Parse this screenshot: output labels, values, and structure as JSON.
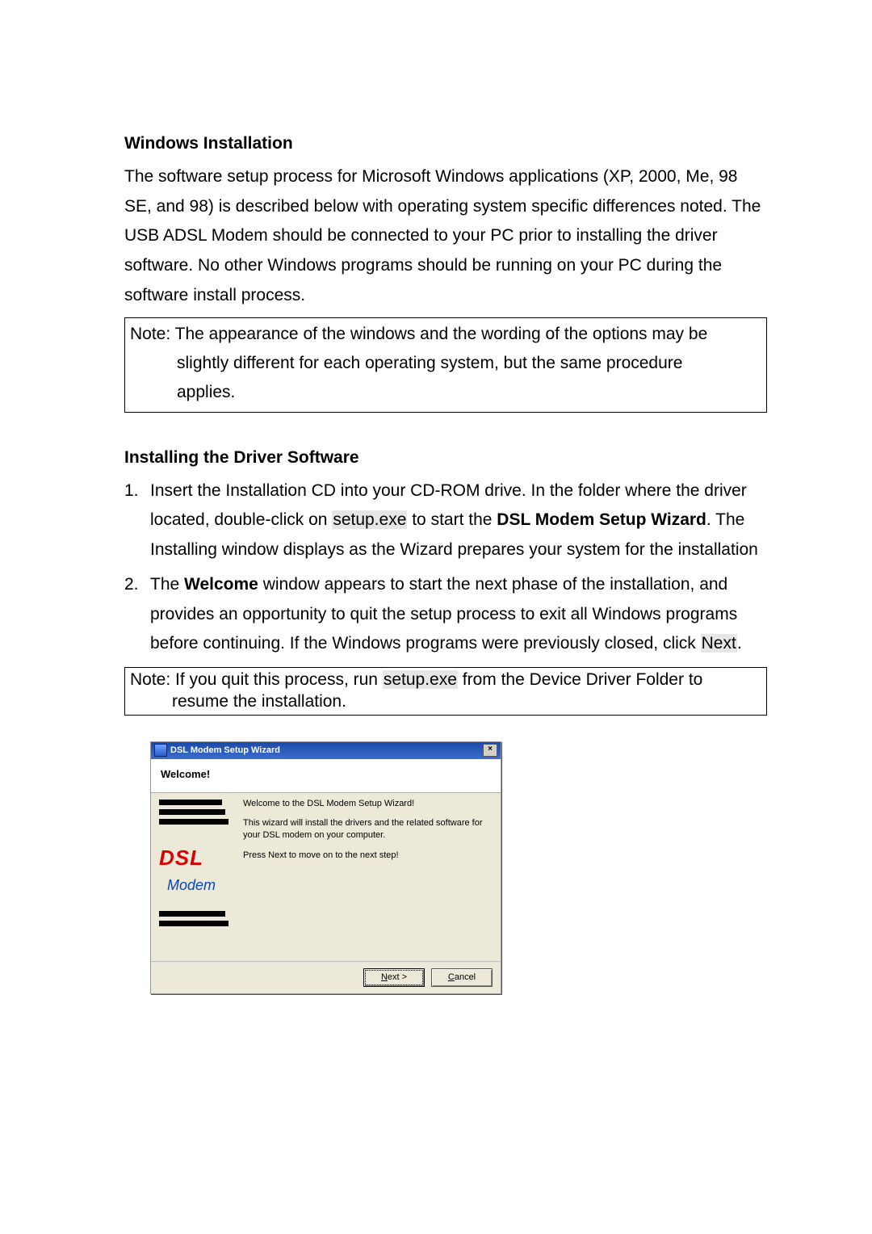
{
  "heading1": "Windows Installation",
  "para1": "The software setup process for Microsoft Windows applications (XP, 2000, Me, 98 SE, and 98) is described below with operating system specific differences noted. The USB ADSL Modem should be connected to your PC prior to installing the driver software. No other Windows programs should be running on your PC during the software install process.",
  "note1_lead": "Note: ",
  "note1_line1": "The appearance of the windows and the wording of the options may be",
  "note1_line2": "slightly different for each operating system, but the same procedure",
  "note1_line3": "applies.",
  "heading2": "Installing the Driver Software",
  "step1": {
    "num": "1.",
    "t1": "Insert the Installation CD into your CD-ROM drive.  In the folder where the driver located, double-click on ",
    "setup": "setup.exe",
    "t2": " to start the ",
    "bold1": "DSL Modem Setup Wizard",
    "t3": ". The Installing window displays as the Wizard prepares your system for the installation"
  },
  "step2": {
    "num": "2.",
    "t1": "The ",
    "bold1": "Welcome",
    "t2": " window appears to start the next phase of the installation, and provides an opportunity to quit the setup process to exit all Windows programs before continuing. If the Windows programs were previously closed, click ",
    "next": "Next",
    "t3": "."
  },
  "note2_lead": "Note: ",
  "note2_t1": "If you quit this process, run ",
  "note2_setup": "setup.exe",
  "note2_t2": " from the Device Driver Folder to",
  "note2_line2": "resume the installation.",
  "wizard": {
    "title": "DSL Modem Setup Wizard",
    "header": "Welcome!",
    "p1": "Welcome to the DSL Modem Setup Wizard!",
    "p2": "This wizard will install the drivers and the related software for your DSL modem on your computer.",
    "p3": "Press Next to move on to the next step!",
    "logo_dsl": "DSL",
    "logo_modem": "Modem",
    "btn_next": "Next >",
    "btn_cancel": "Cancel",
    "close": "×"
  }
}
